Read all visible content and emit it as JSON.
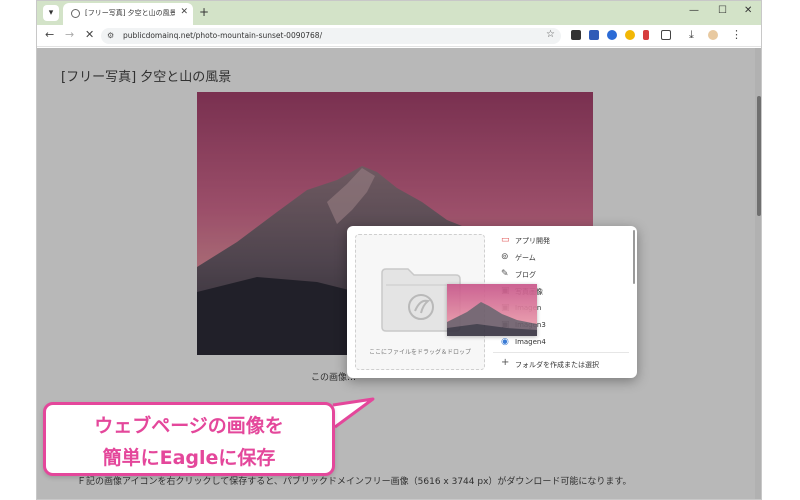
{
  "browser": {
    "tab_title": "[フリー写真] 夕空と山の風景 | パ",
    "tab_list_icon": "chevron-down-icon",
    "new_tab_label": "+",
    "url": "publicdomainq.net/photo-mountain-sunset-0090768/",
    "accent_color": "#d3e3c8",
    "window_minimize": "—",
    "window_maximize": "☐",
    "window_close": "✕"
  },
  "page": {
    "title": "[フリー写真] 夕空と山の風景",
    "caption": "この画像…",
    "description": "Ｆ記の画像アイコンを右クリックして保存すると、パブリックドメインフリー画像（5616 x 3744 px）がダウンロード可能になります。",
    "scroll_position": 0.1
  },
  "eagle_popup": {
    "drop_hint": "ここにファイルをドラッグ＆ドロップ",
    "folders": [
      {
        "label": "アプリ開発",
        "icon": "monitor-icon",
        "color": "#e05555"
      },
      {
        "label": "ゲーム",
        "icon": "gamepad-icon",
        "color": "#555555"
      },
      {
        "label": "ブログ",
        "icon": "pen-icon",
        "color": "#555555"
      },
      {
        "label": "写真画像",
        "icon": "image-icon",
        "color": "#555555"
      },
      {
        "label": "Imagen",
        "icon": "image-icon",
        "color": "#555555"
      },
      {
        "label": "Imagen3",
        "icon": "image-icon",
        "color": "#555555"
      },
      {
        "label": "Imagen4",
        "icon": "globe-icon",
        "color": "#3a7bd5"
      }
    ],
    "create_folder_label": "フォルダを作成または選択"
  },
  "callout": {
    "line1": "ウェブページの画像を",
    "line2": "簡単にEagleに保存",
    "color": "#e4479b"
  }
}
